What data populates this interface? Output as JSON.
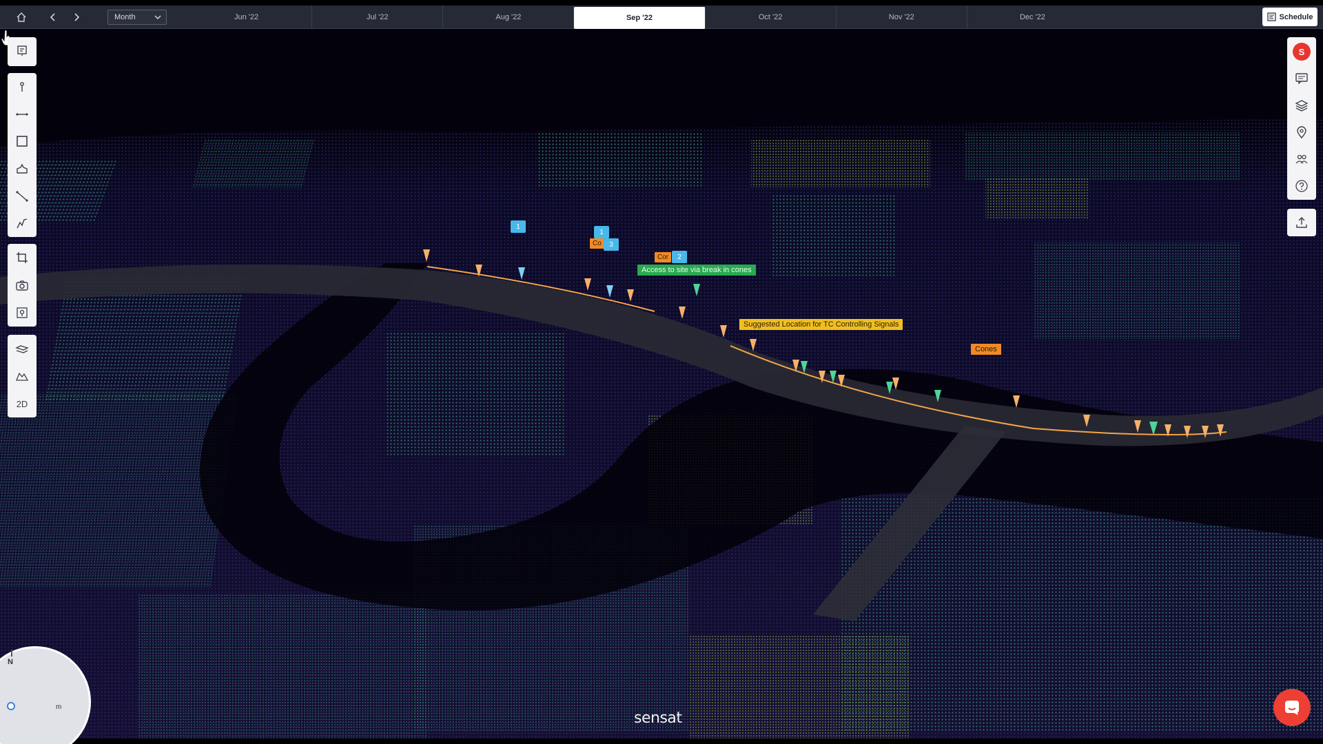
{
  "app": {
    "logo_text": "sensat",
    "brand_color": "#ee3f34"
  },
  "topbar": {
    "view_select": {
      "selected": "Month"
    },
    "months": [
      "Jun '22",
      "Jul '22",
      "Aug '22",
      "Sep '22",
      "Oct '22",
      "Nov '22",
      "Dec '22"
    ],
    "active_month": "Sep '22",
    "schedule_label": "Schedule"
  },
  "left_toolbar": {
    "groups": [
      [
        "notes-icon"
      ],
      [
        "pin-icon",
        "line-measure-icon",
        "area-icon",
        "volume-icon",
        "height-icon",
        "profile-icon"
      ],
      [
        "crop-icon",
        "camera-icon",
        "locate-icon"
      ],
      [
        "layers-compare-icon",
        "terrain-icon",
        "2D"
      ]
    ],
    "mode_2d_label": "2D"
  },
  "right_toolbar": {
    "avatar_initial": "S",
    "tools": [
      "comment-icon",
      "layers-icon",
      "location-icon",
      "people-icon",
      "help-icon"
    ],
    "export": "upload-icon"
  },
  "annotations": {
    "access_label": "Access to site via break in cones",
    "signals_label": "Suggested Location for TC Controlling Signals",
    "cones_label": "Cones",
    "cones_partial_1": "Co",
    "cones_partial_2": "Cor",
    "tag_1": "1",
    "tag_1b": "1",
    "tag_2": "2",
    "tag_3": "3"
  },
  "compass": {
    "north": "N",
    "scale_unit": "m"
  },
  "colors": {
    "annotation_green": "#29a950",
    "annotation_yellow": "#f2be1e",
    "annotation_orange": "#f08a25",
    "tag_blue": "#48b8ea"
  }
}
